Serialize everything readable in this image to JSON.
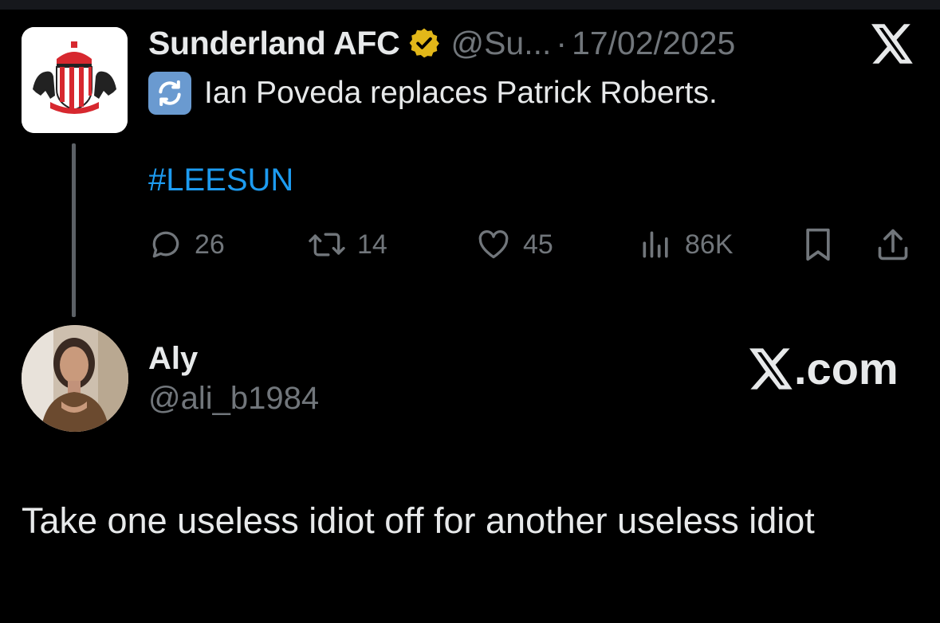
{
  "original_tweet": {
    "display_name": "Sunderland AFC",
    "handle": "@Su...",
    "separator": "·",
    "date": "17/02/2025",
    "emoji": "swap-arrows-emoji",
    "text": "Ian Poveda replaces Patrick Roberts.",
    "hashtag": "#LEESUN",
    "stats": {
      "replies": "26",
      "reposts": "14",
      "likes": "45",
      "views": "86K"
    }
  },
  "reply": {
    "display_name": "Aly",
    "handle": "@ali_b1984",
    "text": "Take one useless idiot off for another useless idiot"
  },
  "watermark": {
    "text": ".com"
  },
  "colors": {
    "background": "#000000",
    "primary_text": "#e7e9ea",
    "secondary_text": "#71767b",
    "link": "#1d9bf0",
    "verified_gold": "#e2b719",
    "club_red": "#d7282f"
  },
  "icons": [
    "club-crest-icon",
    "verified-badge-icon",
    "x-logo-icon",
    "reply-icon",
    "repost-icon",
    "like-icon",
    "views-icon",
    "bookmark-icon",
    "share-icon"
  ]
}
